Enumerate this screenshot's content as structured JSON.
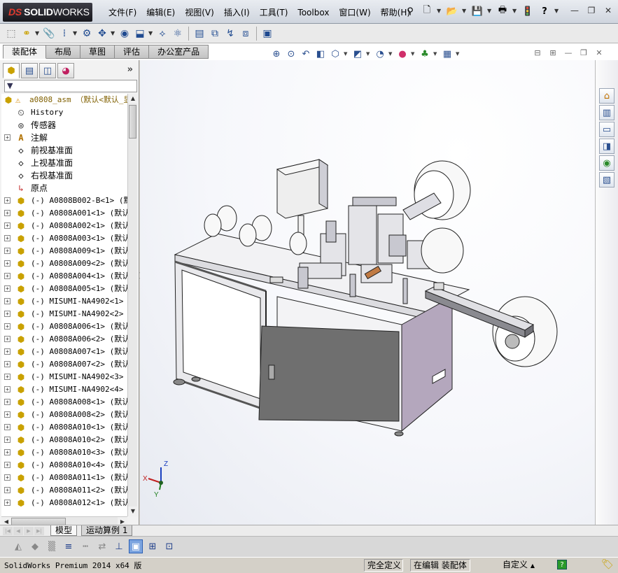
{
  "app": {
    "logo_prefix": "DS",
    "logo_bold": "SOLID",
    "logo_light": "WORKS"
  },
  "menu": [
    "文件(F)",
    "编辑(E)",
    "视图(V)",
    "插入(I)",
    "工具(T)",
    "Toolbox",
    "窗口(W)",
    "帮助(H)"
  ],
  "title_tools": [
    {
      "icon": "pushpin-icon",
      "glyph": "⚲"
    },
    {
      "icon": "new-doc-icon",
      "glyph": "🗋"
    },
    {
      "icon": "open-folder-icon",
      "glyph": "📂"
    },
    {
      "icon": "save-icon",
      "glyph": "💾"
    },
    {
      "icon": "print-icon",
      "glyph": "🖶"
    },
    {
      "icon": "traffic-light-icon",
      "glyph": "🚦"
    },
    {
      "icon": "help-icon",
      "glyph": "?"
    }
  ],
  "command_icons": [
    "insert-component-icon",
    "mate-icon",
    "paperclip-icon",
    "linear-pattern-icon",
    "smart-fasteners-icon",
    "move-component-icon",
    "show-hidden-icon",
    "assembly-feature-icon",
    "reference-geometry-icon",
    "new-motion-icon",
    "bill-of-materials-icon",
    "exploded-view-icon",
    "explode-line-icon",
    "interference-icon",
    "instant3d-icon"
  ],
  "tabs": {
    "items": [
      "装配体",
      "布局",
      "草图",
      "评估",
      "办公室产品"
    ],
    "active": 0
  },
  "hud_icons": [
    "zoom-fit-icon",
    "zoom-area-icon",
    "previous-view-icon",
    "section-view-icon",
    "view-orientation-icon",
    "display-style-icon",
    "hide-show-icon",
    "edit-appearance-icon",
    "apply-scene-icon",
    "view-settings-icon"
  ],
  "panel": {
    "tabs": [
      "feature-manager-icon",
      "property-manager-icon",
      "configuration-manager-icon",
      "display-manager-icon"
    ],
    "expand": "»",
    "filter_glyph": "▼"
  },
  "tree": {
    "root": "a0808_asm （默认<默认_显",
    "items": [
      {
        "label": "History",
        "icon": "history-icon",
        "glyph": "⏲",
        "expander": false,
        "cn": false
      },
      {
        "label": "传感器",
        "icon": "sensor-icon",
        "glyph": "◎",
        "expander": false,
        "cn": true
      },
      {
        "label": "注解",
        "icon": "annotation-icon",
        "glyph": "A",
        "expander": true,
        "cn": true
      },
      {
        "label": "前视基准面",
        "icon": "plane-icon",
        "glyph": "◇",
        "expander": false,
        "cn": true
      },
      {
        "label": "上视基准面",
        "icon": "plane-icon",
        "glyph": "◇",
        "expander": false,
        "cn": true
      },
      {
        "label": "右视基准面",
        "icon": "plane-icon",
        "glyph": "◇",
        "expander": false,
        "cn": true
      },
      {
        "label": "原点",
        "icon": "origin-icon",
        "glyph": "↳",
        "expander": false,
        "cn": true
      },
      {
        "label": "(-) A0808B002-B<1> (默认",
        "icon": "assembly-part-icon",
        "glyph": "⬢",
        "expander": true,
        "cn": false
      },
      {
        "label": "(-) A0808A001<1> (默认<",
        "icon": "assembly-part-icon",
        "glyph": "⬢",
        "expander": true,
        "cn": false
      },
      {
        "label": "(-) A0808A002<1> (默认<",
        "icon": "assembly-part-icon",
        "glyph": "⬢",
        "expander": true,
        "cn": false
      },
      {
        "label": "(-) A0808A003<1> (默认<",
        "icon": "assembly-part-icon",
        "glyph": "⬢",
        "expander": true,
        "cn": false
      },
      {
        "label": "(-) A0808A009<1> (默认<",
        "icon": "assembly-part-icon",
        "glyph": "⬢",
        "expander": true,
        "cn": false
      },
      {
        "label": "(-) A0808A009<2> (默认<",
        "icon": "assembly-part-icon",
        "glyph": "⬢",
        "expander": true,
        "cn": false
      },
      {
        "label": "(-) A0808A004<1> (默认<",
        "icon": "assembly-part-icon",
        "glyph": "⬢",
        "expander": true,
        "cn": false
      },
      {
        "label": "(-) A0808A005<1> (默认<",
        "icon": "assembly-part-icon",
        "glyph": "⬢",
        "expander": true,
        "cn": false
      },
      {
        "label": "(-) MISUMI-NA4902<1> (默",
        "icon": "assembly-part-icon",
        "glyph": "⬢",
        "expander": true,
        "cn": false
      },
      {
        "label": "(-) MISUMI-NA4902<2> (默",
        "icon": "assembly-part-icon",
        "glyph": "⬢",
        "expander": true,
        "cn": false
      },
      {
        "label": "(-) A0808A006<1> (默认<",
        "icon": "assembly-part-icon",
        "glyph": "⬢",
        "expander": true,
        "cn": false
      },
      {
        "label": "(-) A0808A006<2> (默认<",
        "icon": "assembly-part-icon",
        "glyph": "⬢",
        "expander": true,
        "cn": false
      },
      {
        "label": "(-) A0808A007<1> (默认<",
        "icon": "assembly-part-icon",
        "glyph": "⬢",
        "expander": true,
        "cn": false
      },
      {
        "label": "(-) A0808A007<2> (默认<",
        "icon": "assembly-part-icon",
        "glyph": "⬢",
        "expander": true,
        "cn": false
      },
      {
        "label": "(-) MISUMI-NA4902<3> (默",
        "icon": "assembly-part-icon",
        "glyph": "⬢",
        "expander": true,
        "cn": false
      },
      {
        "label": "(-) MISUMI-NA4902<4> (默",
        "icon": "assembly-part-icon",
        "glyph": "⬢",
        "expander": true,
        "cn": false
      },
      {
        "label": "(-) A0808A008<1> (默认<",
        "icon": "assembly-part-icon",
        "glyph": "⬢",
        "expander": true,
        "cn": false
      },
      {
        "label": "(-) A0808A008<2> (默认<",
        "icon": "assembly-part-icon",
        "glyph": "⬢",
        "expander": true,
        "cn": false
      },
      {
        "label": "(-) A0808A010<1> (默认<",
        "icon": "assembly-part-icon",
        "glyph": "⬢",
        "expander": true,
        "cn": false
      },
      {
        "label": "(-) A0808A010<2> (默认<",
        "icon": "assembly-part-icon",
        "glyph": "⬢",
        "expander": true,
        "cn": false
      },
      {
        "label": "(-) A0808A010<3> (默认<",
        "icon": "assembly-part-icon",
        "glyph": "⬢",
        "expander": true,
        "cn": false
      },
      {
        "label": "(-) A0808A010<4> (默认<",
        "icon": "assembly-part-icon",
        "glyph": "⬢",
        "expander": true,
        "cn": false
      },
      {
        "label": "(-) A0808A011<1> (默认<",
        "icon": "assembly-part-icon",
        "glyph": "⬢",
        "expander": true,
        "cn": false
      },
      {
        "label": "(-) A0808A011<2> (默认<",
        "icon": "assembly-part-icon",
        "glyph": "⬢",
        "expander": true,
        "cn": false
      },
      {
        "label": "(-) A0808A012<1> (默认<",
        "icon": "assembly-part-icon",
        "glyph": "⬢",
        "expander": true,
        "cn": false
      }
    ]
  },
  "triad": {
    "x": "X",
    "y": "Y",
    "z": "Z"
  },
  "task_icons": [
    "home-icon",
    "design-library-icon",
    "file-explorer-icon",
    "view-palette-icon",
    "appearances-icon",
    "custom-properties-icon"
  ],
  "bottom_tabs": {
    "items": [
      "模型",
      "运动算例 1"
    ],
    "active": 0
  },
  "bottom_tools": [
    {
      "icon": "shaded-edges-icon",
      "on": false,
      "sel": false
    },
    {
      "icon": "shaded-icon",
      "on": false,
      "sel": false
    },
    {
      "icon": "draft-quality-icon",
      "on": false,
      "sel": false
    },
    {
      "icon": "line-weight-icon",
      "on": true,
      "sel": false
    },
    {
      "icon": "dashed-line-icon",
      "on": false,
      "sel": false
    },
    {
      "icon": "switch-icon",
      "on": false,
      "sel": false
    },
    {
      "icon": "origin-axes-icon",
      "on": true,
      "sel": false
    },
    {
      "icon": "box-view-icon",
      "on": true,
      "sel": true
    },
    {
      "icon": "table-icon",
      "on": true,
      "sel": false
    },
    {
      "icon": "save-view-icon",
      "on": true,
      "sel": false
    }
  ],
  "status": {
    "product": "SolidWorks Premium 2014 x64 版",
    "defined": "完全定义",
    "editing": "在编辑 装配体",
    "units": "自定义",
    "help": "?"
  },
  "colors": {
    "accent": "#2b5fb4",
    "part_icon": "#c9a100",
    "cabinet_door": "#6f6f6f",
    "cabinet_side": "#b4a7bd"
  }
}
